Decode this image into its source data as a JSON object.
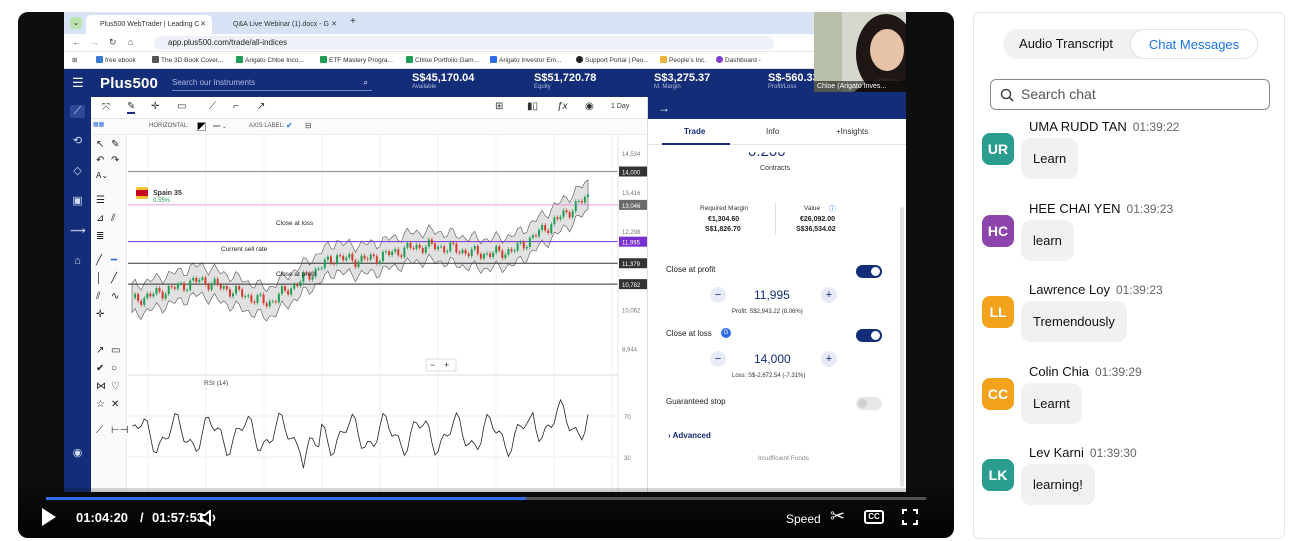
{
  "browser": {
    "tabs": [
      {
        "title": "Plus500 WebTrader | Leading C",
        "active": true
      },
      {
        "title": "Q&A Live Webinar (1).docx - G",
        "active": false
      }
    ],
    "url": "app.plus500.com/trade/all-indices",
    "bookmarks": [
      "free ebook",
      "The 3D Book Cover...",
      "Arigato Chloe Inco...",
      "ETF Mastery Progra...",
      "Chloe Portfolio Gam...",
      "Arigato Investor Em...",
      "Support Portal | Peo...",
      "People's Inc.",
      "Dashboard -"
    ]
  },
  "plus500": {
    "logo": "Plus500",
    "search_placeholder": "Search our Instruments",
    "stats": [
      {
        "value": "S$45,170.04",
        "label": "Available"
      },
      {
        "value": "S$51,720.78",
        "label": "Equity"
      },
      {
        "value": "S$3,275.37",
        "label": "M. Margin"
      },
      {
        "value": "S$-560.33",
        "label": "Profit/Loss"
      }
    ],
    "notification_count": "6"
  },
  "chart": {
    "interval": "1 Day",
    "horizontal_label": "HORIZONTAL:",
    "axis_label": "AXIS LABEL:",
    "instrument": "Spain 35",
    "change": "0.55%",
    "lines": {
      "close_at_loss": "Close at loss",
      "current_sell_rate": "Current sell rate",
      "close_at_profit": "Close at profit"
    },
    "price_ticks": [
      "14,534",
      "14,000",
      "13,416",
      "13,046",
      "12,298",
      "11,995",
      "11,379",
      "10,782",
      "10,062",
      "8,944"
    ],
    "rsi_label": "RSI (14)",
    "rsi_ticks": [
      "70",
      "30"
    ]
  },
  "trade_panel": {
    "tabs": [
      "Trade",
      "Info",
      "+Insights"
    ],
    "amount_partial": "0.200",
    "amount_unit": "Contracts",
    "required_margin_label": "Required Margin",
    "required_margin": [
      "€1,304.60",
      "S$1,826.70"
    ],
    "value_label": "Value",
    "value": [
      "€26,092.00",
      "S$36,534.02"
    ],
    "close_at_profit_label": "Close at profit",
    "close_at_profit_value": "11,995",
    "profit_text": "Profit: S$2,943.22 (8.06%)",
    "close_at_loss_label": "Close at loss",
    "close_at_loss_value": "14,000",
    "loss_text": "Loss: S$-2,672.54 (-7.31%)",
    "guaranteed_stop_label": "Guaranteed stop",
    "advanced_label": "Advanced",
    "insufficient_funds": "Insufficient Funds"
  },
  "webcam": {
    "label": "Chloe (Arigato Inves..."
  },
  "player": {
    "current_time": "01:04:20",
    "separator": "/",
    "total_time": "01:57:53",
    "progress": 0.545,
    "speed_label": "Speed"
  },
  "chat": {
    "tabs": {
      "audio": "Audio Transcript",
      "messages": "Chat Messages"
    },
    "search_placeholder": "Search chat",
    "messages": [
      {
        "initials": "UR",
        "name": "UMA RUDD TAN",
        "time": "01:39:22",
        "text": "Learn",
        "color": "#2a9d8f"
      },
      {
        "initials": "HC",
        "name": "HEE CHAI YEN",
        "time": "01:39:23",
        "text": "learn",
        "color": "#8e44ad"
      },
      {
        "initials": "LL",
        "name": "Lawrence Loy",
        "time": "01:39:23",
        "text": "Tremendously",
        "color": "#f2a21b"
      },
      {
        "initials": "CC",
        "name": "Colin Chia",
        "time": "01:39:29",
        "text": "Learnt",
        "color": "#f2a21b"
      },
      {
        "initials": "LK",
        "name": "Lev Karni",
        "time": "01:39:30",
        "text": "learning!",
        "color": "#2a9d8f"
      }
    ]
  }
}
